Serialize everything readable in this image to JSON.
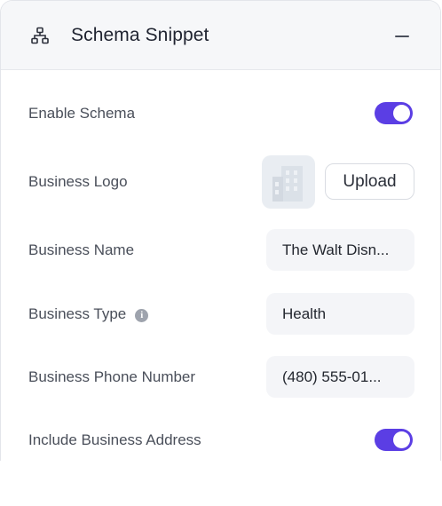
{
  "header": {
    "icon": "sitemap-icon",
    "title": "Schema Snippet",
    "collapse_icon": "minus-icon"
  },
  "rows": {
    "enable_schema": {
      "label": "Enable Schema",
      "toggle_on": true
    },
    "business_logo": {
      "label": "Business Logo",
      "thumb_icon": "building-icon",
      "upload_label": "Upload"
    },
    "business_name": {
      "label": "Business Name",
      "value": "The Walt Disn..."
    },
    "business_type": {
      "label": "Business Type",
      "info_icon": "info-icon",
      "info_glyph": "i",
      "value": "Health"
    },
    "business_phone": {
      "label": "Business Phone Number",
      "value": "(480) 555-01..."
    },
    "include_address": {
      "label": "Include Business Address",
      "toggle_on": true
    }
  },
  "colors": {
    "accent": "#5b3ee4",
    "header_bg": "#f6f7f9",
    "field_bg": "#f4f5f8"
  }
}
